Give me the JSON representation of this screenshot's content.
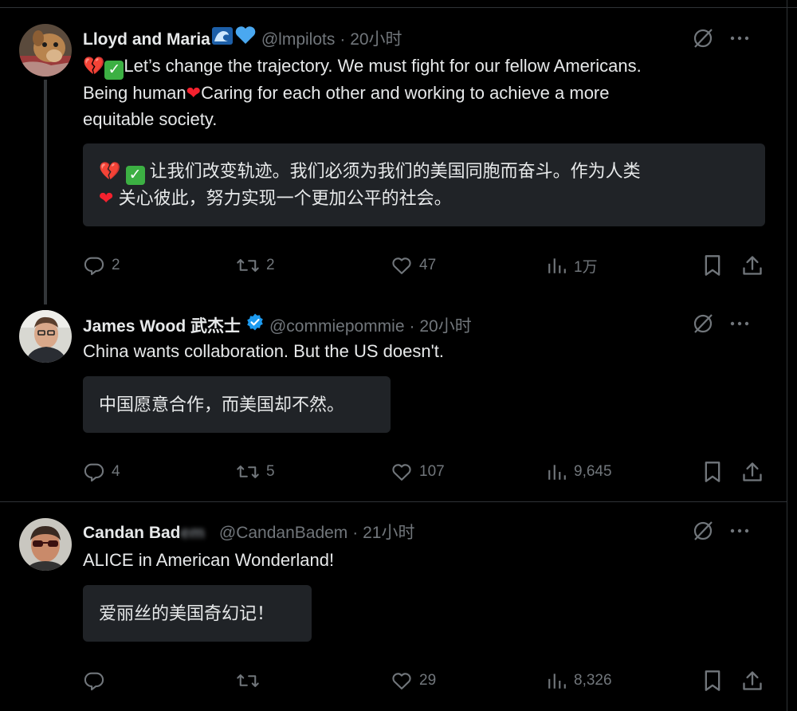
{
  "tweets": [
    {
      "name": "Lloyd and Maria",
      "handle": "@lmpilots",
      "time": "· 20小时",
      "text_line1": "Let’s change the trajectory. We must fight for our fellow Americans.",
      "text_line2a": "Being human",
      "text_line2b": "Caring for each other and working to achieve a more",
      "text_line3": "equitable society.",
      "translation_line1": "让我们改变轨迹。我们必须为我们的美国同胞而奋斗。作为人类",
      "translation_line2": "关心彼此，努力实现一个更加公平的社会。",
      "replies": "2",
      "retweets": "2",
      "likes": "47",
      "views": "1万"
    },
    {
      "name": "James Wood 武杰士",
      "handle": "@commiepommie",
      "time": "· 20小时",
      "text": "China wants collaboration. But the US doesn't.",
      "translation": "中国愿意合作，而美国却不然。",
      "replies": "4",
      "retweets": "5",
      "likes": "107",
      "views": "9,645"
    },
    {
      "name": "Candan Bad",
      "name_blurred": "em",
      "handle": "@CandanBadem",
      "time": "· 21小时",
      "text": "ALICE in American Wonderland!",
      "translation": "爱丽丝的美国奇幻记！",
      "replies": "",
      "retweets": "",
      "likes": "29",
      "views": "8,326"
    }
  ],
  "colors": {
    "background": "#000000",
    "text": "#e7e9ea",
    "secondary": "#71767b",
    "translation_bg": "#202327",
    "verified": "#1d9bf0",
    "heart": "#f4212e"
  },
  "icons": [
    "reply-icon",
    "retweet-icon",
    "like-icon",
    "views-icon",
    "bookmark-icon",
    "share-icon",
    "grok-icon",
    "more-icon"
  ]
}
